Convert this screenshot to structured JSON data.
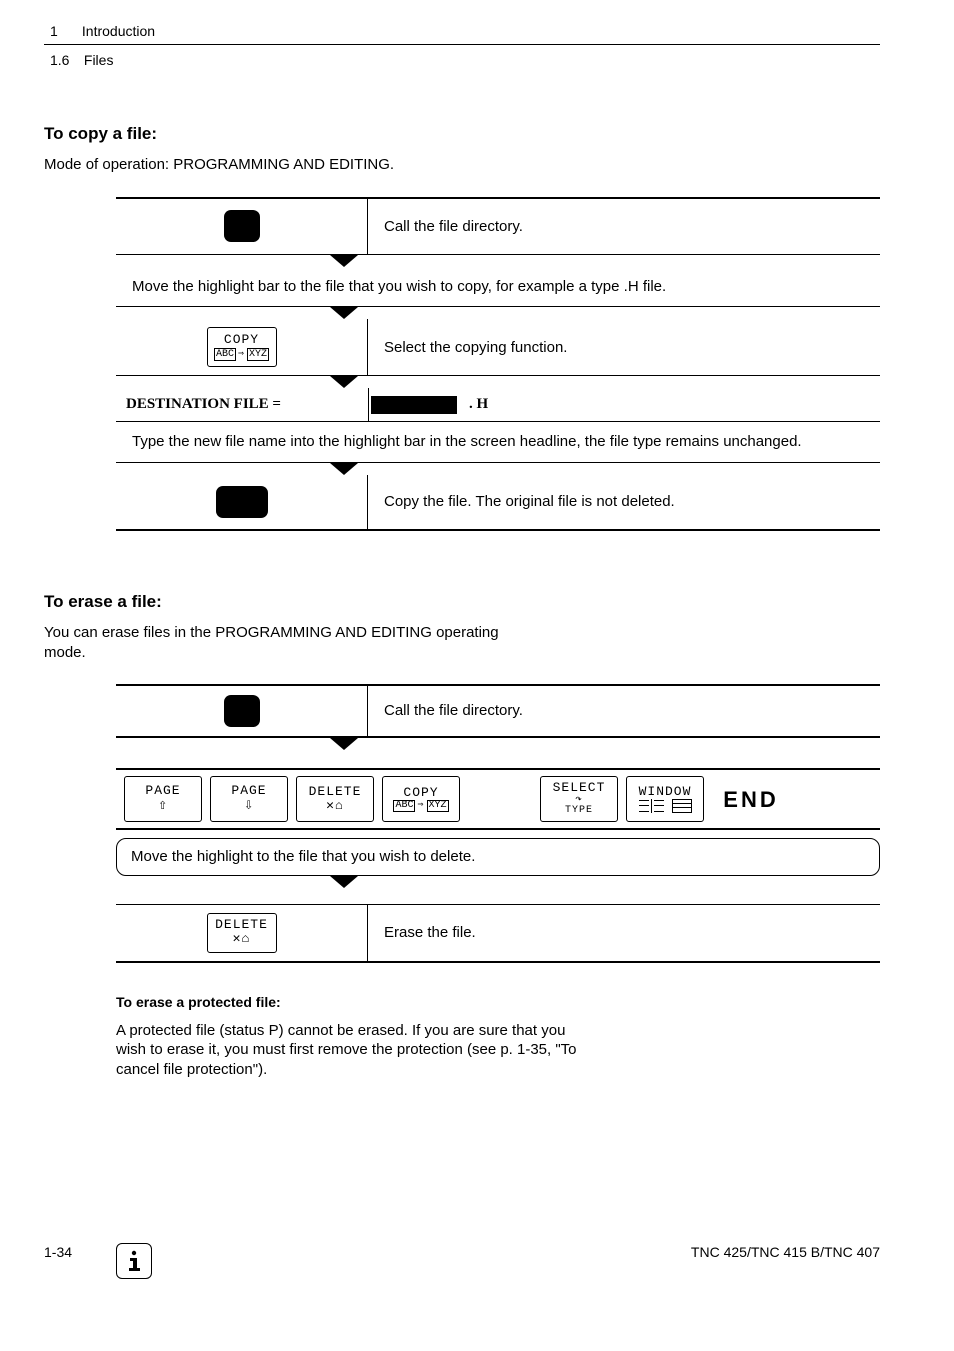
{
  "header": {
    "chapter_num": "1",
    "chapter_title": "Introduction",
    "section_num": "1.6",
    "section_title": "Files"
  },
  "copy": {
    "title": "To copy a file:",
    "mode_text": "Mode of operation: PROGRAMMING AND EDITING.",
    "step1_text": "Call the file directory.",
    "step2_text": "Move the highlight bar to the file that you wish to copy, for example a type .H file.",
    "copy_key_line1": "COPY",
    "copy_key_abc": "ABC",
    "copy_key_xyz": "XYZ",
    "step3_text": "Select the copying function.",
    "dest_label": "DESTINATION FILE =",
    "dest_ext": ". H",
    "step4_text": "Type the new file name into the highlight bar in the screen headline, the file type remains unchanged.",
    "step5_text": "Copy the file. The original file is not deleted."
  },
  "erase": {
    "title": "To erase a file:",
    "intro": "You can erase files in the PROGRAMMING AND EDITING operating mode.",
    "step1_text": "Call the file directory.",
    "softkeys": {
      "page_up": "PAGE",
      "page_down": "PAGE",
      "delete": "DELETE",
      "copy": "COPY",
      "select_l1": "SELECT",
      "select_l2": "TYPE",
      "window": "WINDOW",
      "end": "END"
    },
    "step2_text": "Move the highlight to the file that you wish to delete.",
    "delete_key": "DELETE",
    "step3_text": "Erase the file.",
    "protected_title": "To erase a protected file:",
    "protected_text": "A protected file (status P) cannot be erased.  If you are sure that you wish to erase it, you must first remove the protection (see p. 1-35, \"To cancel file protection\")."
  },
  "footer": {
    "page": "1-34",
    "model": "TNC 425/TNC 415 B/TNC 407"
  }
}
